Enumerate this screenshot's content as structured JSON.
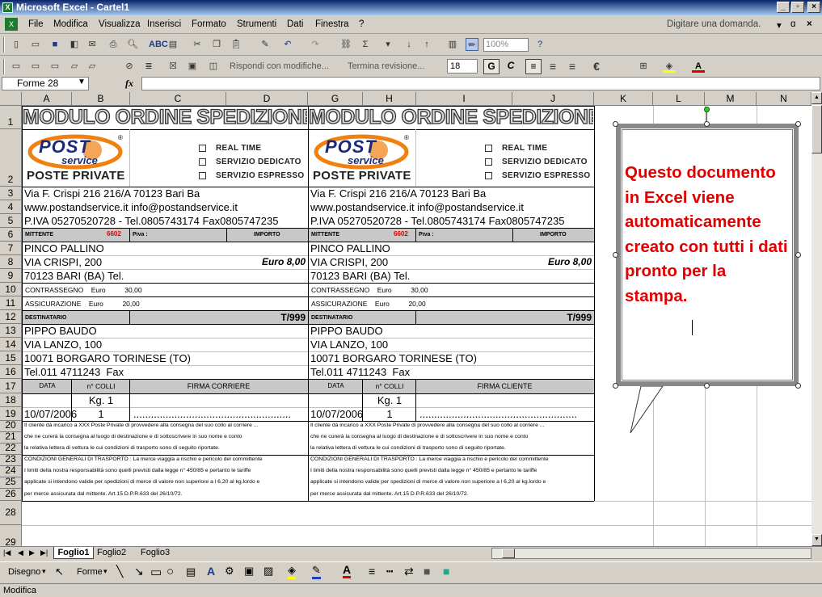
{
  "window": {
    "title": "Microsoft Excel - Cartel1",
    "app_icon": "excel-icon"
  },
  "menu": [
    "File",
    "Modifica",
    "Visualizza",
    "Inserisci",
    "Formato",
    "Strumenti",
    "Dati",
    "Finestra",
    "?"
  ],
  "help_box": "Digitare una domanda.",
  "toolbar": {
    "zoom": "100%",
    "review_reply": "Rispondi con modifiche...",
    "review_end": "Termina revisione...",
    "font_size": "18",
    "bold": "G",
    "italic": "C"
  },
  "formula_bar": {
    "name_box": "Forme 28",
    "fx": "fx"
  },
  "columns": [
    "A",
    "B",
    "C",
    "D",
    "G",
    "H",
    "I",
    "J",
    "K",
    "L",
    "M",
    "N"
  ],
  "rows": [
    "1",
    "2",
    "3",
    "4",
    "5",
    "6",
    "7",
    "8",
    "9",
    "10",
    "11",
    "12",
    "13",
    "14",
    "15",
    "16",
    "17",
    "18",
    "19",
    "20",
    "21",
    "22",
    "23",
    "24",
    "25",
    "26",
    "28",
    "29"
  ],
  "form": {
    "title": "MODULO ORDINE SPEDIZIONE",
    "logo_main": "POST",
    "logo_sub": "service",
    "logo_reg": "®",
    "logo_caption": "POSTE PRIVATE",
    "options": [
      "REAL TIME",
      "SERVIZIO DEDICATO",
      "SERVIZIO ESPRESSO"
    ],
    "address": "Via F. Crispi 216 216/A 70123 Bari Ba",
    "web": "www.postandservice.it    info@postandservice.it",
    "piva": "P.IVA 05270520728 - Tel.0805743174 Fax0805747235",
    "mittente_label": "MITTENTE",
    "mittente_code": "6602",
    "piva_label": "Piva :",
    "importo_label": "IMPORTO",
    "sender_name": "PINCO PALLINO",
    "sender_street": "VIA CRISPI, 200",
    "amount": "Euro 8,00",
    "sender_city": "70123 BARI (BA) Tel.",
    "contrassegno": "CONTRASSEGNO    Euro          30,00",
    "assicurazione": "ASSICURAZIONE    Euro          20,00",
    "destinatario_label": "DESTINATARIO",
    "tcode": "T/999",
    "rec_name": "PIPPO BAUDO",
    "rec_street": "VIA LANZO, 100",
    "rec_city": "10071 BORGARO TORINESE (TO)",
    "rec_tel": "Tel.011 4711243  Fax",
    "data_label": "DATA",
    "colli_label": "n° COLLI",
    "firma_corriere": "FIRMA CORRIERE",
    "firma_cliente": "FIRMA CLIENTE",
    "kg": "Kg. 1",
    "date": "10/07/2006",
    "colli": "1",
    "dots": "......................................................",
    "note1": "Il cliente dà incarico a XXX Poste Private di provvedere alla consegna del suo collo al corriere ...",
    "note2": "che ne curerà la consegna al luogo di destinazione e di sottoscrivere in suo nome e conto",
    "note3": "la relativa lettera di vettura le cui condizioni di trasporto sono di seguito riportate.",
    "note4": "CONDIZIONI GENERALI DI TRASPORTO :  La merce viaggia a rischio e pericolo del committente",
    "note5": "I limiti della nostra responsabilità sono  quelli previsti dalla legge n° 450/85 e pertanto le tariffe",
    "note6": " applicate si intendono valide per spedizioni di merce di valore non superiore a l 6,20 al kg.lordo e",
    "note7": "per merce assicurata dal mittente. Art.15 D.P.R.633 del 26/10/72."
  },
  "callout_text": "Questo documento in Excel viene automaticamente creato con tutti i dati pronto per la stampa.",
  "sheet_tabs": [
    "Foglio1",
    "Foglio2",
    "Foglio3"
  ],
  "draw_toolbar": {
    "draw": "Disegno",
    "shapes": "Forme"
  },
  "status": "Modifica"
}
